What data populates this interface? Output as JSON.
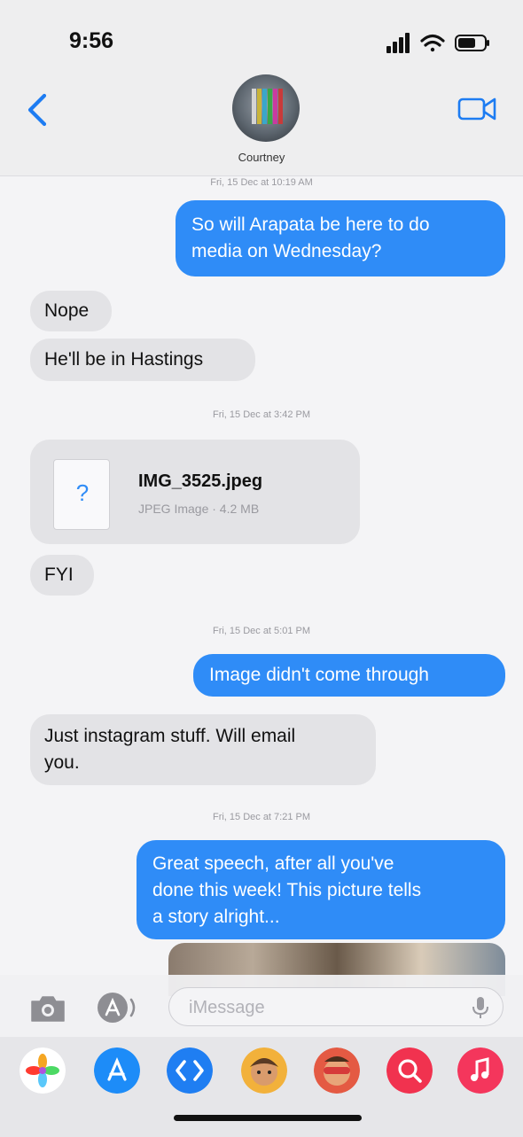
{
  "status_bar": {
    "time": "9:56"
  },
  "header": {
    "contact_name": "Courtney"
  },
  "messages": [
    {
      "type": "timestamp",
      "text": "Fri, 15 Dec at 10:19 AM"
    },
    {
      "type": "outgoing",
      "text": "So will Arapata be here to do\nmedia on Wednesday?"
    },
    {
      "type": "incoming",
      "text": "Nope"
    },
    {
      "type": "incoming",
      "text": "He'll be in Hastings"
    },
    {
      "type": "timestamp",
      "text": "Fri, 15 Dec at 3:42 PM"
    },
    {
      "type": "attachment",
      "file_name": "IMG_3525.jpeg",
      "file_meta": "JPEG Image · 4.2 MB",
      "glyph": "?"
    },
    {
      "type": "incoming",
      "text": "FYI"
    },
    {
      "type": "timestamp",
      "text": "Fri, 15 Dec at 5:01 PM"
    },
    {
      "type": "outgoing",
      "text": "Image didn't come through"
    },
    {
      "type": "incoming",
      "text": "Just instagram stuff. Will email\nyou."
    },
    {
      "type": "timestamp",
      "text": "Fri, 15 Dec at 7:21 PM"
    },
    {
      "type": "outgoing",
      "text": "Great speech, after all you've\ndone this week! This picture tells\na story alright..."
    }
  ],
  "composer": {
    "placeholder": "iMessage"
  },
  "app_drawer": [
    {
      "name": "photos-app-icon",
      "color": "#ffffff"
    },
    {
      "name": "app-store-icon",
      "color": "#1d8cf8"
    },
    {
      "name": "shazam-icon",
      "color": "#1f7ef2"
    },
    {
      "name": "memoji-stickers-icon",
      "color": "#f2b13b"
    },
    {
      "name": "animoji-icon",
      "color": "#e45a43"
    },
    {
      "name": "search-images-icon",
      "color": "#f1324f"
    },
    {
      "name": "music-app-icon",
      "color": "#f4365c"
    }
  ],
  "colors": {
    "outgoing": "#2f8cf7",
    "incoming": "#e3e3e6",
    "accent": "#1d7cf2"
  }
}
